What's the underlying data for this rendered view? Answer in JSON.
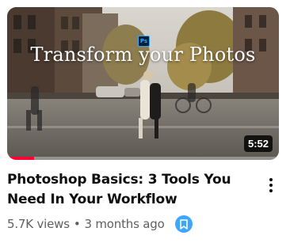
{
  "video": {
    "thumbnail_text": "Transform your Photos",
    "thumbnail_badge": "Ps",
    "duration": "5:52",
    "watch_progress": 0.1,
    "title": "Photoshop Basics: 3 Tools You Need In Your Workflow",
    "views": "5.7K views",
    "separator": "•",
    "age": "3 months ago",
    "save_icon": "bookmark-icon",
    "menu_icon": "more-vertical-icon"
  },
  "colors": {
    "progress": "#ff0033",
    "save_badge": "#3ea6ff",
    "title": "#0f0f0f",
    "meta": "#606060"
  }
}
